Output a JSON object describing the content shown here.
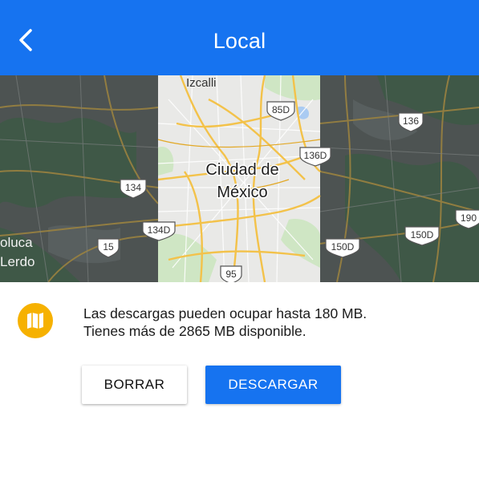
{
  "header": {
    "title": "Local",
    "back_icon": "back-arrow-icon"
  },
  "map": {
    "labels": {
      "izcalli": "Izcalli",
      "city_line1": "Ciudad de",
      "city_line2": "México",
      "toluca": "oluca",
      "lerdo": "Lerdo"
    },
    "shields": {
      "s85d": "85D",
      "s136": "136",
      "s136d": "136D",
      "s134": "134",
      "s134d": "134D",
      "s15": "15",
      "s150d_a": "150D",
      "s150d_b": "150D",
      "s190": "190",
      "s95": "95"
    },
    "colors": {
      "road": "#f3c24a",
      "dark_bg": "#4a4f4f",
      "light_bg": "#e8e8e6"
    }
  },
  "info": {
    "icon": "map-icon",
    "line1": "Las descargas pueden ocupar hasta 180 MB.",
    "line2": "Tienes más de 2865 MB disponible."
  },
  "buttons": {
    "clear": "BORRAR",
    "download": "DESCARGAR"
  },
  "colors": {
    "primary": "#1673f0",
    "icon_bg": "#f6b100"
  }
}
